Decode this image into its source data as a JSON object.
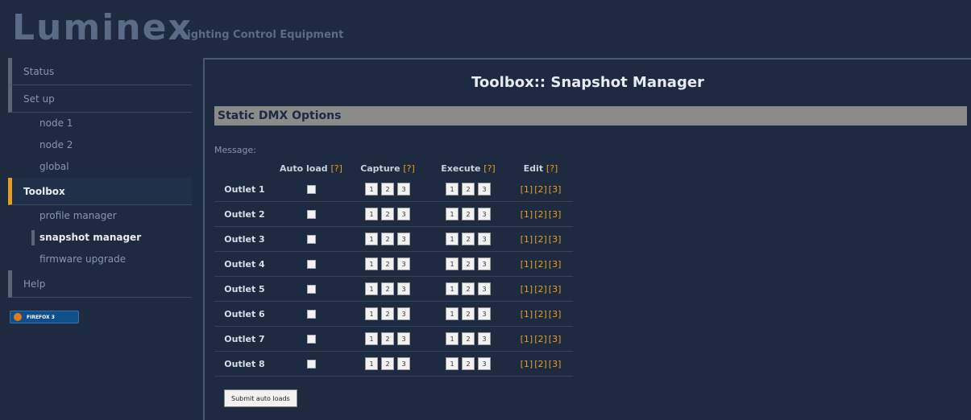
{
  "header": {
    "logo": "Luminex",
    "tagline": "Lighting Control Equipment"
  },
  "sidebar": {
    "items": [
      {
        "label": "Status",
        "level": "top"
      },
      {
        "label": "Set up",
        "level": "top"
      },
      {
        "label": "node 1",
        "level": "sub"
      },
      {
        "label": "node 2",
        "level": "sub"
      },
      {
        "label": "global",
        "level": "sub"
      },
      {
        "label": "Toolbox",
        "level": "top",
        "active": true
      },
      {
        "label": "profile manager",
        "level": "sub"
      },
      {
        "label": "snapshot manager",
        "level": "sub",
        "active": true
      },
      {
        "label": "firmware upgrade",
        "level": "sub"
      },
      {
        "label": "Help",
        "level": "top"
      }
    ],
    "badge_text": "FIREFOX 3"
  },
  "main": {
    "title": "Toolbox:: Snapshot Manager",
    "section": "Static DMX Options",
    "message_label": "Message:",
    "columns": {
      "auto_load": "Auto load",
      "capture": "Capture",
      "execute": "Execute",
      "edit": "Edit",
      "help": "[?]"
    },
    "outlets": [
      {
        "name": "Outlet 1"
      },
      {
        "name": "Outlet 2"
      },
      {
        "name": "Outlet 3"
      },
      {
        "name": "Outlet 4"
      },
      {
        "name": "Outlet 5"
      },
      {
        "name": "Outlet 6"
      },
      {
        "name": "Outlet 7"
      },
      {
        "name": "Outlet 8"
      }
    ],
    "slot_numbers": [
      "1",
      "2",
      "3"
    ],
    "edit_links": [
      "[1]",
      "[2]",
      "[3]"
    ],
    "submit_label": "Submit auto loads"
  },
  "colors": {
    "background": "#1d2a3f",
    "accent": "#e6a021",
    "section_bar": "#8b8b8b"
  }
}
